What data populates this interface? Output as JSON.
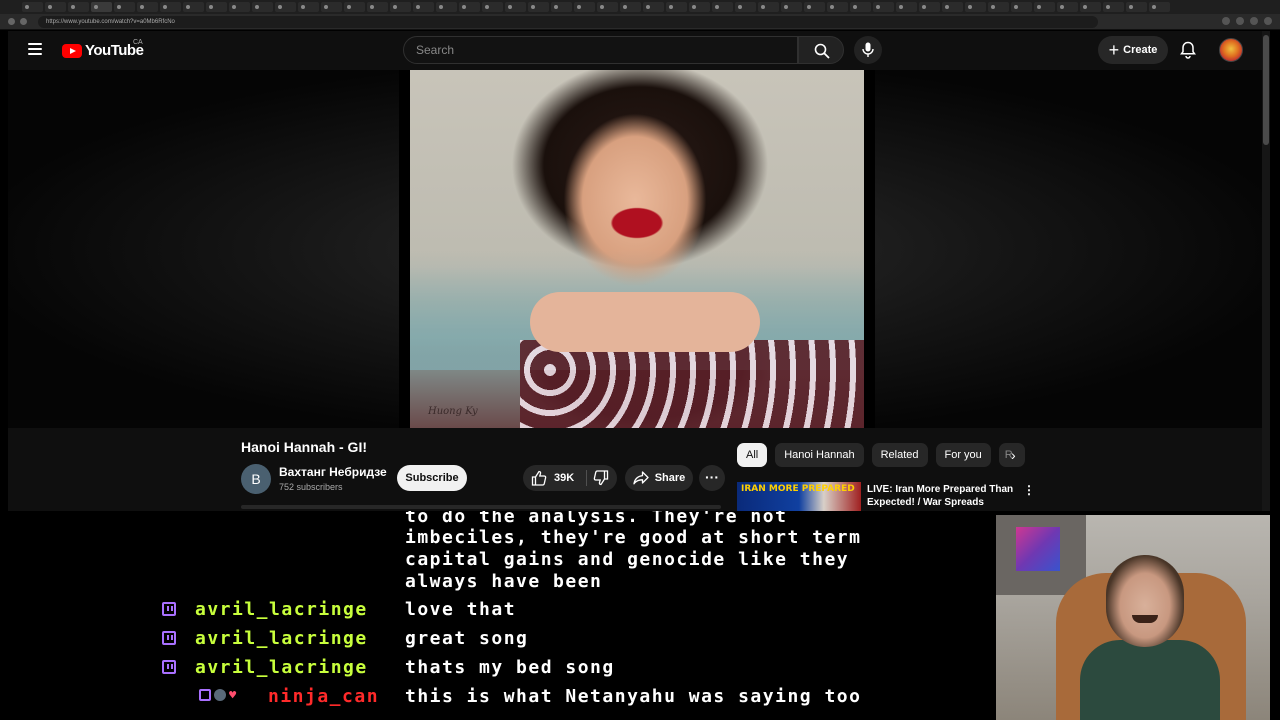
{
  "browser": {
    "url": "https://www.youtube.com/watch?v=a0Mb6RfcNo"
  },
  "youtube": {
    "logo_text": "YouTube",
    "country_code": "CA",
    "search_placeholder": "Search",
    "create_label": "Create",
    "video": {
      "title": "Hanoi Hannah - GI!",
      "channel_initial": "B",
      "channel_name": "Вахтанг Небридзе",
      "subscribers": "752 subscribers",
      "subscribe_label": "Subscribe",
      "likes": "39K",
      "share_label": "Share"
    },
    "chips": [
      {
        "label": "All",
        "active": true
      },
      {
        "label": "Hanoi Hannah",
        "active": false
      },
      {
        "label": "Related",
        "active": false
      },
      {
        "label": "For you",
        "active": false
      },
      {
        "label": "R",
        "active": false
      }
    ],
    "recommendation": {
      "thumb_text": "IRAN MORE PREPARED",
      "title": "LIVE: Iran More Prepared Than Expected! / War Spreads Acro..."
    }
  },
  "chat": {
    "continuation": [
      "to do the analysis. They're not",
      "imbeciles, they're good at short term",
      "capital gains and genocide like they",
      "always have been"
    ],
    "messages": [
      {
        "user": "avril_lacringe",
        "text": "love that",
        "color": "#c8ff3c"
      },
      {
        "user": "avril_lacringe",
        "text": "great song",
        "color": "#c8ff3c"
      },
      {
        "user": "avril_lacringe",
        "text": "thats my bed song",
        "color": "#c8ff3c"
      },
      {
        "user": "ninja_can",
        "text": "this is what Netanyahu was saying too",
        "color": "#ff2a2a"
      }
    ]
  },
  "colors": {
    "twitch_purple": "#a970ff",
    "youtube_red": "#ff0000"
  }
}
